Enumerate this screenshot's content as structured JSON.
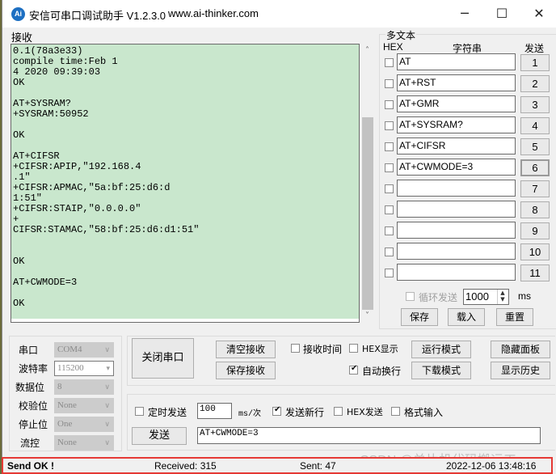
{
  "window": {
    "app_icon": "ai-thinker-logo-icon",
    "app_icon_text": "Ai",
    "title": "安信可串口调试助手 V1.2.3.0",
    "url": "www.ai-thinker.com",
    "controls": {
      "minimize": "─",
      "maximize": "☐",
      "close": "✕"
    }
  },
  "receive": {
    "label": "接收",
    "text": "0.1(78a3e33)\ncompile time:Feb 1\n4 2020 09:39:03\nOK\n\nAT+SYSRAM?\n+SYSRAM:50952\n\nOK\n\nAT+CIFSR\n+CIFSR:APIP,\"192.168.4\n.1\"\n+CIFSR:APMAC,\"5a:bf:25:d6:d\n1:51\"\n+CIFSR:STAIP,\"0.0.0.0\"\n+\nCIFSR:STAMAC,\"58:bf:25:d6:d1:51\"\n\n\nOK\n\nAT+CWMODE=3\n\nOK",
    "scroll_up": "˄",
    "scroll_down": "˅"
  },
  "multi_text": {
    "title": "多文本",
    "col_hex": "HEX",
    "col_string": "字符串",
    "col_send": "发送",
    "rows": [
      {
        "hex": false,
        "value": "AT",
        "button": "1"
      },
      {
        "hex": false,
        "value": "AT+RST",
        "button": "2"
      },
      {
        "hex": false,
        "value": "AT+GMR",
        "button": "3"
      },
      {
        "hex": false,
        "value": "AT+SYSRAM?",
        "button": "4"
      },
      {
        "hex": false,
        "value": "AT+CIFSR",
        "button": "5"
      },
      {
        "hex": false,
        "value": "AT+CWMODE=3",
        "button": "6"
      },
      {
        "hex": false,
        "value": "",
        "button": "7"
      },
      {
        "hex": false,
        "value": "",
        "button": "8"
      },
      {
        "hex": false,
        "value": "",
        "button": "9"
      },
      {
        "hex": false,
        "value": "",
        "button": "10"
      },
      {
        "hex": false,
        "value": "",
        "button": "11"
      }
    ],
    "loop_send_label": "循环发送",
    "loop_interval": "1000",
    "loop_unit": "ms",
    "save": "保存",
    "load": "载入",
    "reset": "重置"
  },
  "port": {
    "port_label": "串口",
    "port_value": "COM4",
    "baud_label": "波特率",
    "baud_value": "115200",
    "databits_label": "数据位",
    "databits_value": "8",
    "parity_label": "校验位",
    "parity_value": "None",
    "stopbits_label": "停止位",
    "stopbits_value": "One",
    "flow_label": "流控",
    "flow_value": "None",
    "close_port": "关闭串口"
  },
  "controls": {
    "clear_receive": "清空接收",
    "save_receive": "保存接收",
    "recv_time_label": "接收时间",
    "hex_display_label": "HEX显示",
    "auto_wrap_label": "自动换行",
    "run_mode": "运行模式",
    "download_mode": "下载模式",
    "hide_panel": "隐藏面板",
    "show_history": "显示历史"
  },
  "send": {
    "timed_send_label": "定时发送",
    "interval": "100",
    "interval_unit": "ms/次",
    "send_newline_label": "发送新行",
    "hex_send_label": "HEX发送",
    "format_input_label": "格式输入",
    "send_button": "发送",
    "input": "AT+CWMODE=3"
  },
  "status": {
    "message": "Send OK !",
    "received": "Received: 315",
    "sent": "Sent: 47",
    "datetime": "2022-12-06 13:48:16",
    "highlight_color": "#e53935"
  },
  "watermark": "CSDN @单片机代码搬运工"
}
